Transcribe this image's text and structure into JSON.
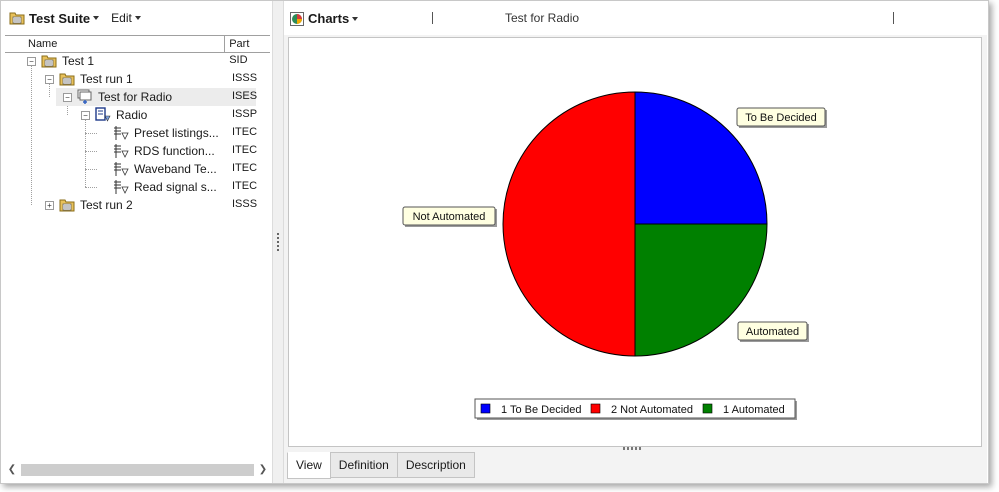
{
  "left_panel": {
    "suite_title": "Test Suite",
    "edit_menu": "Edit",
    "columns": {
      "name": "Name",
      "part_sid": "Part SID"
    },
    "tree": [
      {
        "label": "Test 1",
        "sid": "",
        "level": 0,
        "icon": "folder-icon",
        "toggle": "minus"
      },
      {
        "label": "Test run 1",
        "sid": "ISSS",
        "level": 1,
        "icon": "folder-icon",
        "toggle": "minus"
      },
      {
        "label": "Test for Radio",
        "sid": "ISES",
        "level": 2,
        "icon": "test-set-icon",
        "toggle": "minus",
        "selected": true
      },
      {
        "label": "Radio",
        "sid": "ISSP",
        "level": 3,
        "icon": "test-spec-icon",
        "toggle": "minus"
      },
      {
        "label": "Preset listings...",
        "sid": "ITEC",
        "level": 4,
        "icon": "test-case-icon",
        "toggle": ""
      },
      {
        "label": "RDS function...",
        "sid": "ITEC",
        "level": 4,
        "icon": "test-case-icon",
        "toggle": ""
      },
      {
        "label": "Waveband Te...",
        "sid": "ITEC",
        "level": 4,
        "icon": "test-case-icon",
        "toggle": ""
      },
      {
        "label": "Read signal s...",
        "sid": "ITEC",
        "level": 4,
        "icon": "test-case-icon",
        "toggle": ""
      },
      {
        "label": "Test run 2",
        "sid": "ISSS",
        "level": 1,
        "icon": "folder-icon",
        "toggle": "plus"
      }
    ]
  },
  "right_panel": {
    "charts_menu": "Charts",
    "chart_name": "Test for Radio",
    "tabs": [
      {
        "label": "View",
        "active": true
      },
      {
        "label": "Definition",
        "active": false
      },
      {
        "label": "Description",
        "active": false
      }
    ]
  },
  "chart_data": {
    "type": "pie",
    "slices": [
      {
        "label": "To Be Decided",
        "value": 1,
        "color": "#0000ff",
        "legend": "1 To Be Decided"
      },
      {
        "label": "Automated",
        "value": 1,
        "color": "#008000",
        "legend": "1 Automated"
      },
      {
        "label": "Not Automated",
        "value": 2,
        "color": "#ff0000",
        "legend": "2 Not Automated"
      }
    ],
    "legend_placement": "bottom"
  }
}
